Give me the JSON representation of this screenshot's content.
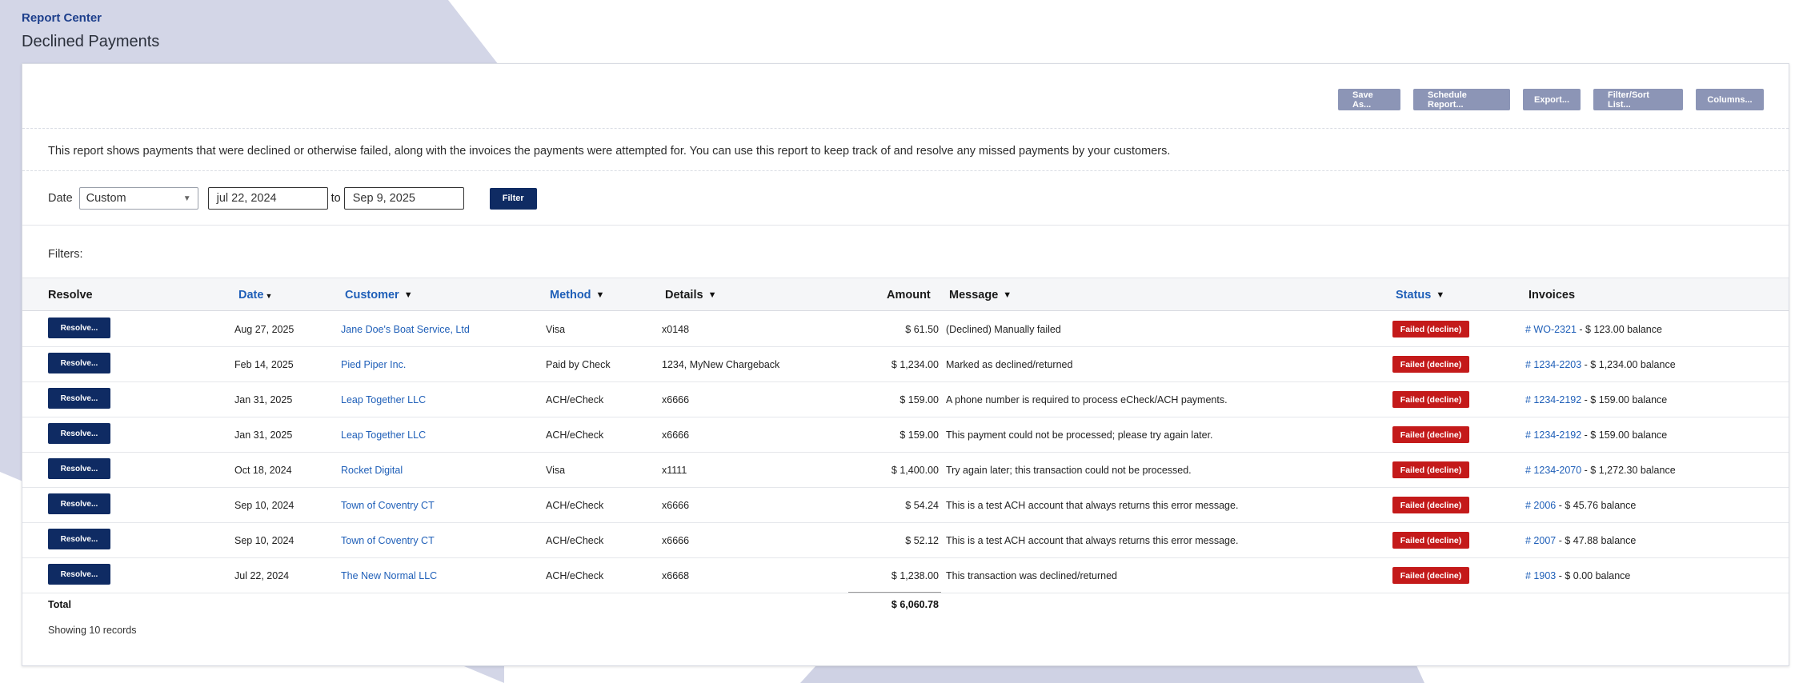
{
  "header": {
    "breadcrumb": "Report Center",
    "title": "Declined Payments"
  },
  "toolbar": {
    "save_as": "Save As...",
    "schedule": "Schedule Report...",
    "export": "Export...",
    "filter_sort": "Filter/Sort List...",
    "columns": "Columns..."
  },
  "description": "This report shows payments that were declined or otherwise failed, along with the invoices the payments were attempted for. You can use this report to keep track of and resolve any missed payments by your customers.",
  "date_filter": {
    "label": "Date",
    "range_value": "Custom",
    "from": "jul 22, 2024",
    "to_label": "to",
    "to": "Sep 9, 2025",
    "filter_button": "Filter"
  },
  "filters_label": "Filters:",
  "columns": {
    "resolve": "Resolve",
    "date": "Date",
    "customer": "Customer",
    "method": "Method",
    "details": "Details",
    "amount": "Amount",
    "message": "Message",
    "status": "Status",
    "invoices": "Invoices"
  },
  "rows": [
    {
      "resolve": "Resolve...",
      "date": "Aug 27, 2025",
      "customer": "Jane Doe's Boat Service, Ltd",
      "method": "Visa",
      "details": "x0148",
      "amount": "$ 61.50",
      "message": "(Declined) Manually failed",
      "status": "Failed (decline)",
      "invoice": "# WO-2321",
      "balance": " - $ 123.00 balance"
    },
    {
      "resolve": "Resolve...",
      "date": "Feb 14, 2025",
      "customer": "Pied Piper Inc.",
      "method": "Paid by Check",
      "details": "1234, MyNew Chargeback",
      "amount": "$ 1,234.00",
      "message": "Marked as declined/returned",
      "status": "Failed (decline)",
      "invoice": "# 1234-2203",
      "balance": " - $ 1,234.00 balance"
    },
    {
      "resolve": "Resolve...",
      "date": "Jan 31, 2025",
      "customer": "Leap Together LLC",
      "method": "ACH/eCheck",
      "details": "x6666",
      "amount": "$ 159.00",
      "message": "A phone number is required to process eCheck/ACH payments.",
      "status": "Failed (decline)",
      "invoice": "# 1234-2192",
      "balance": " - $ 159.00 balance"
    },
    {
      "resolve": "Resolve...",
      "date": "Jan 31, 2025",
      "customer": "Leap Together LLC",
      "method": "ACH/eCheck",
      "details": "x6666",
      "amount": "$ 159.00",
      "message": "This payment could not be processed; please try again later.",
      "status": "Failed (decline)",
      "invoice": "# 1234-2192",
      "balance": " - $ 159.00 balance"
    },
    {
      "resolve": "Resolve...",
      "date": "Oct 18, 2024",
      "customer": "Rocket Digital",
      "method": "Visa",
      "details": "x1111",
      "amount": "$ 1,400.00",
      "message": "Try again later; this transaction could not be processed.",
      "status": "Failed (decline)",
      "invoice": "# 1234-2070",
      "balance": " - $ 1,272.30 balance"
    },
    {
      "resolve": "Resolve...",
      "date": "Sep 10, 2024",
      "customer": "Town of Coventry CT",
      "method": "ACH/eCheck",
      "details": "x6666",
      "amount": "$ 54.24",
      "message": "This is a test ACH account that always returns this error message.",
      "status": "Failed (decline)",
      "invoice": "# 2006",
      "balance": " - $ 45.76 balance"
    },
    {
      "resolve": "Resolve...",
      "date": "Sep 10, 2024",
      "customer": "Town of Coventry CT",
      "method": "ACH/eCheck",
      "details": "x6666",
      "amount": "$ 52.12",
      "message": "This is a test ACH account that always returns this error message.",
      "status": "Failed (decline)",
      "invoice": "# 2007",
      "balance": " - $ 47.88 balance"
    },
    {
      "resolve": "Resolve...",
      "date": "Jul 22, 2024",
      "customer": "The New Normal LLC",
      "method": "ACH/eCheck",
      "details": "x6668",
      "amount": "$ 1,238.00",
      "message": "This transaction was declined/returned",
      "status": "Failed (decline)",
      "invoice": "# 1903",
      "balance": " - $ 0.00 balance"
    }
  ],
  "total": {
    "label": "Total",
    "amount": "$ 6,060.78"
  },
  "showing": "Showing 10 records",
  "icons": {
    "filter": "funnel-icon",
    "sort": "sort-desc-icon",
    "dropdown": "chevron-down-icon"
  },
  "colors": {
    "brand": "#0f2b63",
    "link": "#1f5fb8",
    "toolbar_button": "#8c95b6",
    "status_failed": "#c41a1a"
  }
}
